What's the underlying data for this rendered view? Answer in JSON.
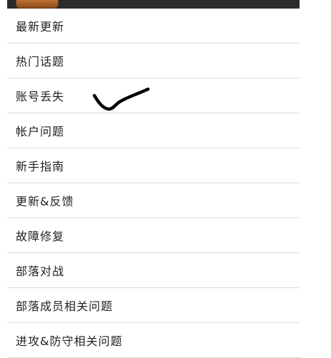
{
  "menu": {
    "items": [
      {
        "label": "最新更新"
      },
      {
        "label": "热门话题"
      },
      {
        "label": "账号丢失"
      },
      {
        "label": "帐户问题"
      },
      {
        "label": "新手指南"
      },
      {
        "label": "更新&反馈"
      },
      {
        "label": "故障修复"
      },
      {
        "label": "部落对战"
      },
      {
        "label": "部落成员相关问题"
      },
      {
        "label": "进攻&防守相关问题"
      }
    ]
  },
  "annotation": {
    "icon": "handwritten-checkmark-icon",
    "color": "#000000"
  }
}
